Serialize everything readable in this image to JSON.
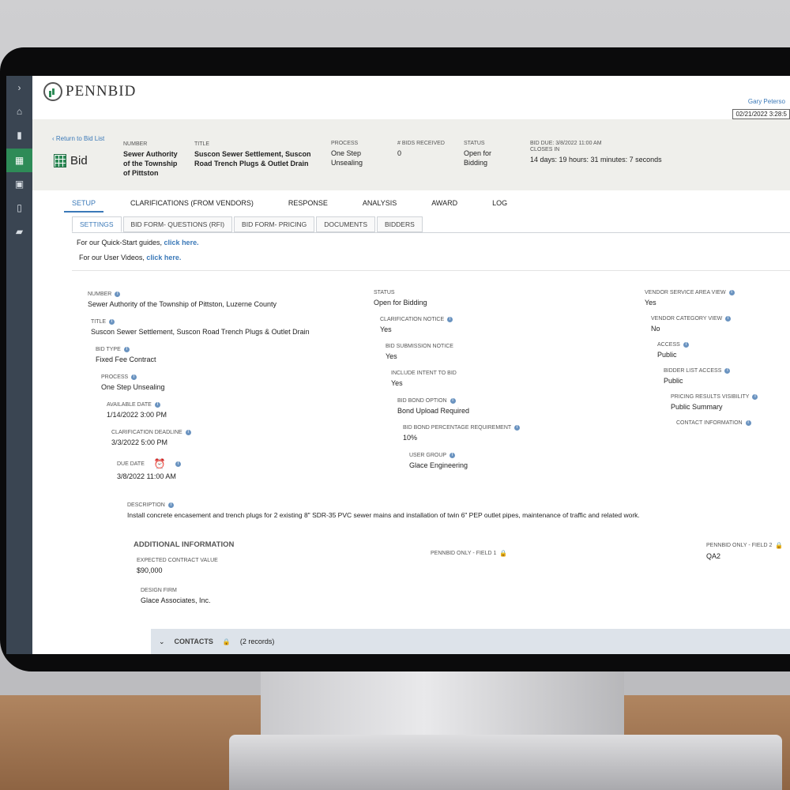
{
  "brand": {
    "name": "PENNBID",
    "user": "Gary Peterso",
    "date": "02/21/2022 3:28:5"
  },
  "sidebar": {
    "items": [
      {
        "icon": "chevron-right-icon",
        "glyph": "›"
      },
      {
        "icon": "home-icon",
        "glyph": "⌂"
      },
      {
        "icon": "bookmark-icon",
        "glyph": "▮"
      },
      {
        "icon": "bid-grid-icon",
        "glyph": "▦"
      },
      {
        "icon": "calendar-icon",
        "glyph": "▣"
      },
      {
        "icon": "document-icon",
        "glyph": "▯"
      },
      {
        "icon": "folder-icon",
        "glyph": "▰"
      }
    ]
  },
  "header": {
    "back_label": "Return to Bid List",
    "bid_label": "Bid",
    "number_label": "NUMBER",
    "number_value": "Sewer Authority of the Township of Pittston",
    "title_label": "TITLE",
    "title_value": "Suscon Sewer Settlement, Suscon Road Trench Plugs & Outlet Drain",
    "process_label": "PROCESS",
    "process_value": "One Step Unsealing",
    "bids_received_label": "# BIDS RECEIVED",
    "bids_received_value": "0",
    "status_label": "STATUS",
    "status_value": "Open for Bidding",
    "bid_due_label": "BID DUE: 3/8/2022 11:00 AM",
    "closes_in_label": "CLOSES IN",
    "closes_in_value": "14 days: 19 hours: 31 minutes: 7 seconds"
  },
  "tabs": [
    "SETUP",
    "CLARIFICATIONS (FROM VENDORS)",
    "RESPONSE",
    "ANALYSIS",
    "AWARD",
    "LOG"
  ],
  "subtabs": [
    "SETTINGS",
    "BID FORM- QUESTIONS (RFI)",
    "BID FORM- PRICING",
    "DOCUMENTS",
    "BIDDERS"
  ],
  "links": {
    "quick_start_text": "For our Quick-Start guides, ",
    "quick_start_link": "click here.",
    "videos_text": "For our User Videos, ",
    "videos_link": "click here."
  },
  "fields": {
    "number": {
      "label": "NUMBER",
      "value": "Sewer Authority of the Township of Pittston, Luzerne County"
    },
    "title": {
      "label": "TITLE",
      "value": "Suscon Sewer Settlement, Suscon Road Trench Plugs & Outlet Drain"
    },
    "bid_type": {
      "label": "BID TYPE",
      "value": "Fixed Fee Contract"
    },
    "process": {
      "label": "PROCESS",
      "value": "One Step Unsealing"
    },
    "available_date": {
      "label": "AVAILABLE DATE",
      "value": "1/14/2022 3:00 PM"
    },
    "clarification_deadline": {
      "label": "CLARIFICATION DEADLINE",
      "value": "3/3/2022 5:00 PM"
    },
    "due_date": {
      "label": "DUE DATE",
      "value": "3/8/2022 11:00 AM"
    },
    "status": {
      "label": "STATUS",
      "value": "Open for Bidding"
    },
    "clarification_notice": {
      "label": "CLARIFICATION NOTICE",
      "value": "Yes"
    },
    "bid_submission_notice": {
      "label": "BID SUBMISSION NOTICE",
      "value": "Yes"
    },
    "include_intent": {
      "label": "INCLUDE INTENT TO BID",
      "value": "Yes"
    },
    "bid_bond_option": {
      "label": "BID BOND OPTION",
      "value": "Bond Upload Required"
    },
    "bid_bond_pct": {
      "label": "BID BOND PERCENTAGE REQUIREMENT",
      "value": "10%"
    },
    "user_group": {
      "label": "USER GROUP",
      "value": "Glace Engineering"
    },
    "vendor_service_area": {
      "label": "VENDOR SERVICE AREA VIEW",
      "value": "Yes"
    },
    "vendor_category": {
      "label": "VENDOR CATEGORY VIEW",
      "value": "No"
    },
    "access": {
      "label": "ACCESS",
      "value": "Public"
    },
    "bidder_list_access": {
      "label": "BIDDER LIST ACCESS",
      "value": "Public"
    },
    "pricing_results": {
      "label": "PRICING RESULTS VISIBILITY",
      "value": "Public Summary"
    },
    "contact_info": {
      "label": "CONTACT INFORMATION",
      "value": ""
    },
    "description": {
      "label": "DESCRIPTION",
      "value": "Install concrete encasement and trench plugs for 2 existing 8\" SDR-35 PVC sewer mains and installation of twin 6\" PEP outlet pipes, maintenance of traffic and related work."
    }
  },
  "additional": {
    "heading": "ADDITIONAL INFORMATION",
    "expected_value": {
      "label": "EXPECTED CONTRACT VALUE",
      "value": "$90,000"
    },
    "design_firm": {
      "label": "DESIGN FIRM",
      "value": "Glace Associates, Inc."
    },
    "field1": {
      "label": "PENNBID ONLY - FIELD 1",
      "value": ""
    },
    "field2": {
      "label": "PENNBID ONLY - FIELD 2",
      "value": "QA2"
    }
  },
  "contacts": {
    "title": "CONTACTS",
    "count": "(2 records)"
  }
}
